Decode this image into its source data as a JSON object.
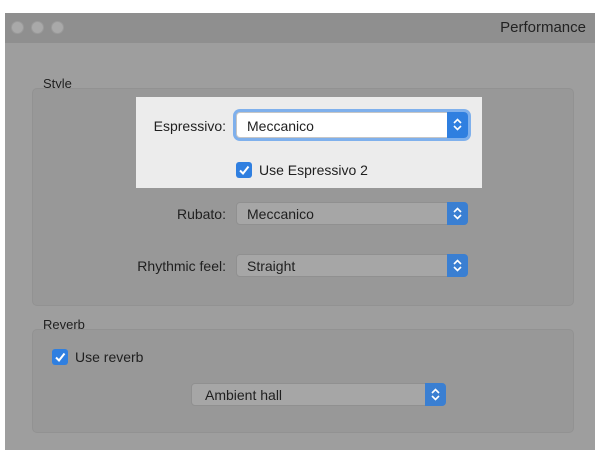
{
  "window": {
    "title": "Performance",
    "traffic_lights": [
      "close",
      "minimize",
      "zoom"
    ]
  },
  "style_group": {
    "label": "Style",
    "espressivo": {
      "label": "Espressivo:",
      "value": "Meccanico"
    },
    "use_espressivo_2": {
      "label": "Use Espressivo 2",
      "checked": true
    },
    "rubato": {
      "label": "Rubato:",
      "value": "Meccanico"
    },
    "rhythmic_feel": {
      "label": "Rhythmic feel:",
      "value": "Straight"
    }
  },
  "reverb_group": {
    "label": "Reverb",
    "use_reverb": {
      "label": "Use reverb",
      "checked": true
    },
    "preset": {
      "value": "Ambient hall"
    }
  },
  "colors": {
    "accent": "#2f7fe0",
    "focus_ring": "#7fb0ec",
    "dimmed_background": "#9e9e9e",
    "highlight_background": "#ececec"
  }
}
